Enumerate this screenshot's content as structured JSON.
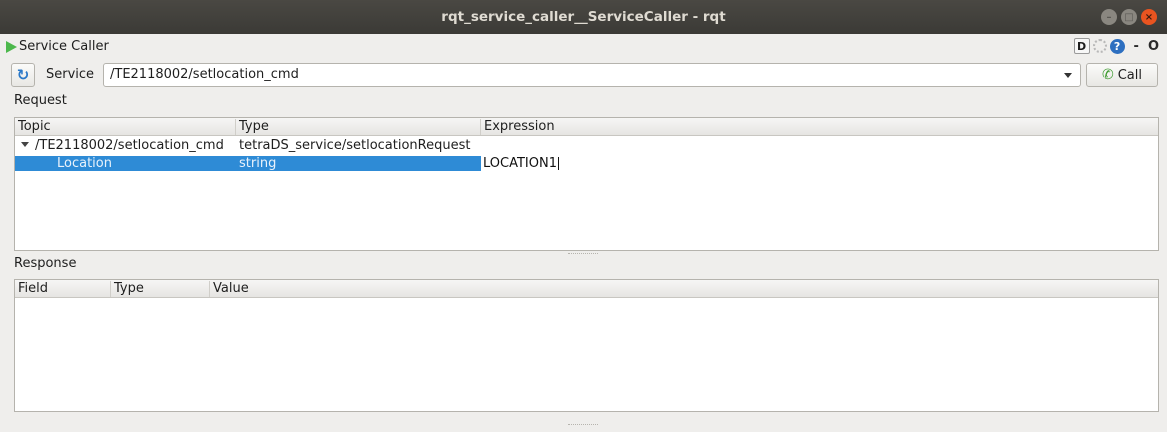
{
  "window": {
    "title": "rqt_service_caller__ServiceCaller - rqt"
  },
  "plugin": {
    "title": "Service Caller",
    "tools": {
      "d_label": "D",
      "help_label": "?",
      "minimize_label": "-",
      "close_label": "O"
    }
  },
  "service": {
    "label": "Service",
    "selected": "/TE2118002/setlocation_cmd",
    "call_label": "Call"
  },
  "request": {
    "label": "Request",
    "columns": [
      "Topic",
      "Type",
      "Expression"
    ],
    "rows": [
      {
        "topic": "/TE2118002/setlocation_cmd",
        "type": "tetraDS_service/setlocationRequest",
        "expression": ""
      },
      {
        "topic": "Location",
        "type": "string",
        "expression": "LOCATION1"
      }
    ]
  },
  "response": {
    "label": "Response",
    "columns": [
      "Field",
      "Type",
      "Value"
    ]
  },
  "icons": {
    "plugin": "play-icon",
    "refresh": "refresh-icon",
    "call": "phone-icon",
    "dropdown": "chevron-down-icon",
    "expand": "caret-down-icon"
  },
  "colors": {
    "titlebar": "#3b3a36",
    "selection": "#2e8bd6",
    "close": "#e95420",
    "play": "#4cb84c"
  }
}
